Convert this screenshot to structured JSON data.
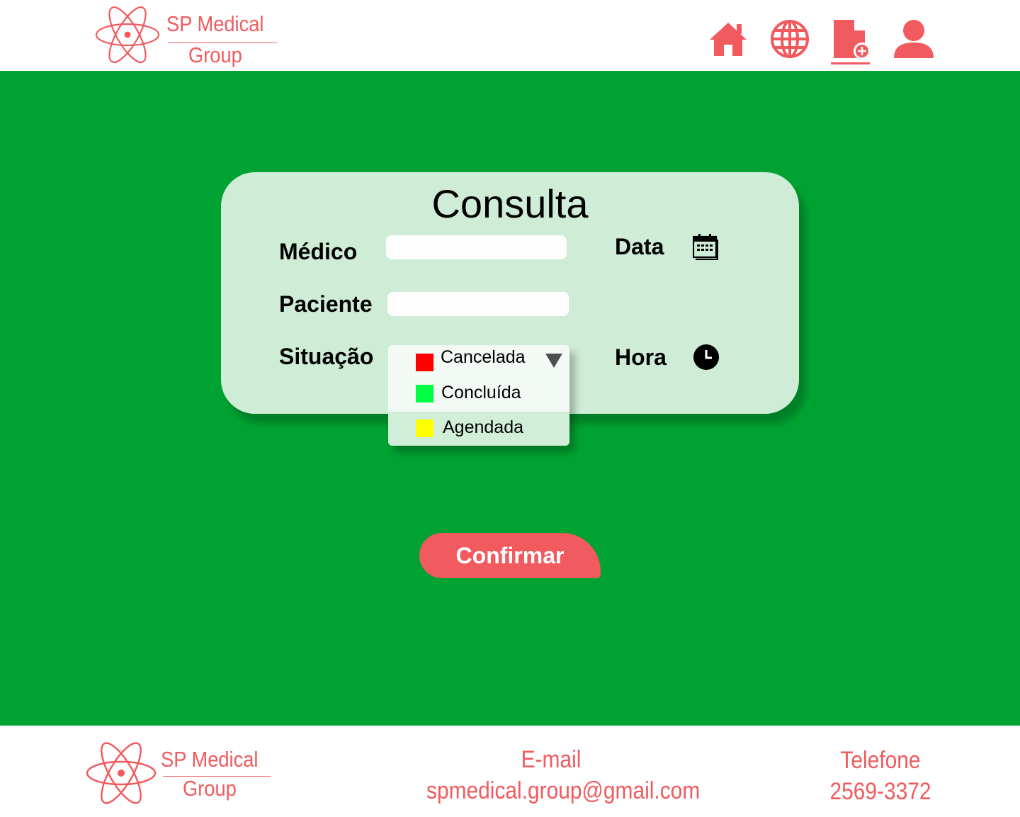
{
  "brand": {
    "name_line1": "SP Medical",
    "name_line2": "Group",
    "color": "#f15a5e"
  },
  "nav": {
    "items": [
      {
        "icon": "home-icon"
      },
      {
        "icon": "globe-icon"
      },
      {
        "icon": "add-document-icon",
        "active": true
      },
      {
        "icon": "user-icon"
      }
    ]
  },
  "form": {
    "title": "Consulta",
    "medico_label": "Médico",
    "medico_value": "",
    "paciente_label": "Paciente",
    "paciente_value": "",
    "situacao_label": "Situação",
    "data_label": "Data",
    "hora_label": "Hora",
    "situacao_options": [
      {
        "label": "Cancelada",
        "color": "#ff0000"
      },
      {
        "label": "Concluída",
        "color": "#00ff44"
      },
      {
        "label": "Agendada",
        "color": "#ffff00"
      }
    ],
    "confirm_label": "Confirmar"
  },
  "footer": {
    "email_title": "E-mail",
    "email_value": "spmedical.group@gmail.com",
    "phone_title": "Telefone",
    "phone_value": "2569-3372"
  },
  "colors": {
    "main_bg": "#00a332",
    "card_bg": "#ceecd6",
    "accent": "#f15a5e"
  }
}
